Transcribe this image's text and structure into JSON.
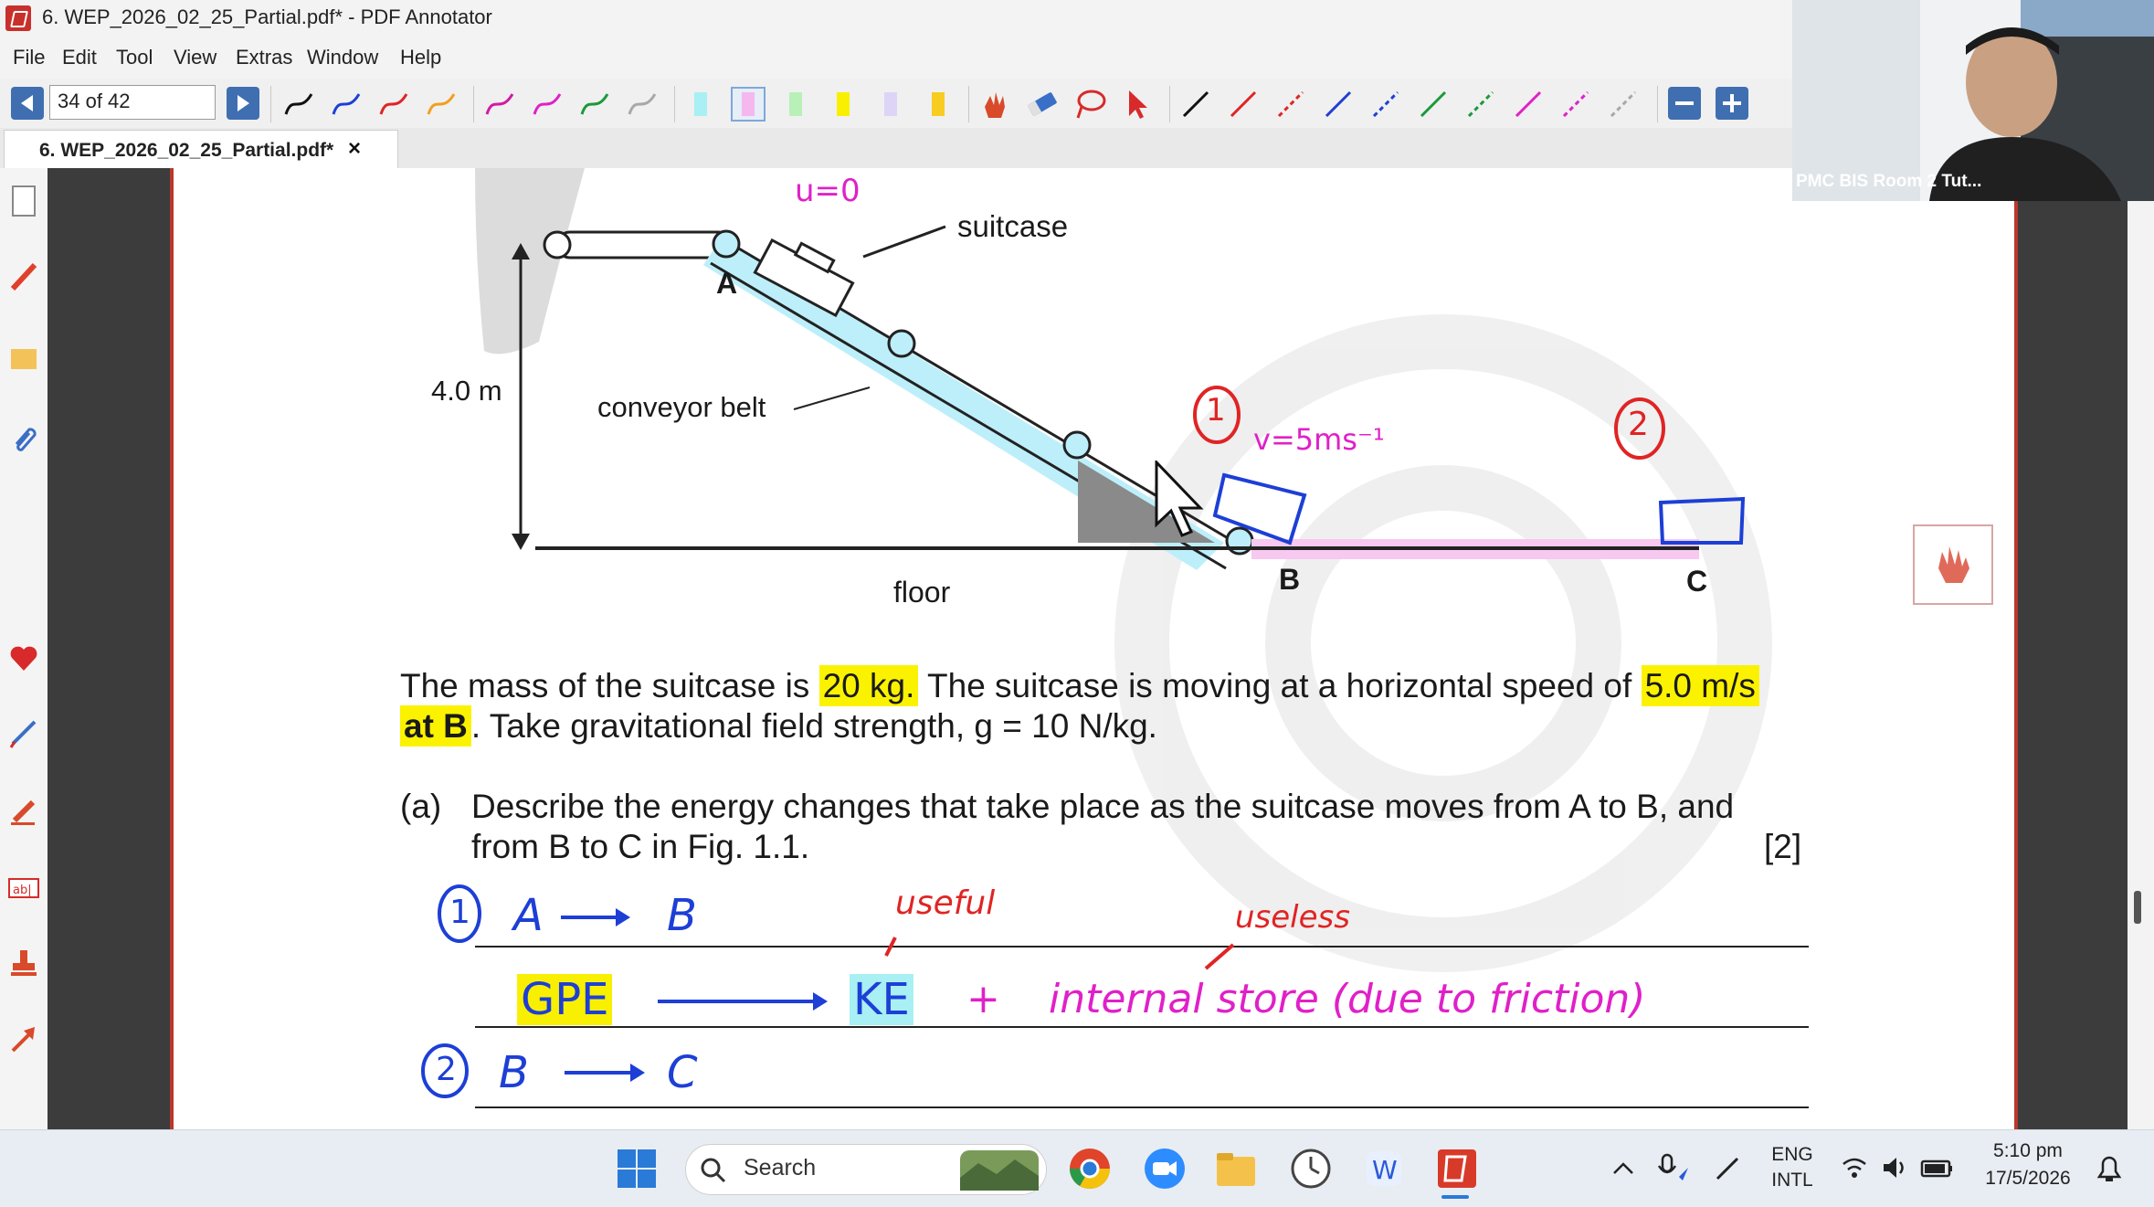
{
  "window": {
    "title": "6. WEP_2026_02_25_Partial.pdf* - PDF Annotator"
  },
  "menu": [
    "File",
    "Edit",
    "Tool",
    "View",
    "Extras",
    "Window",
    "Help"
  ],
  "toolbar": {
    "page_field": "34 of 42"
  },
  "tab": {
    "title": "6. WEP_2026_02_25_Partial.pdf*",
    "close": "×"
  },
  "document": {
    "diagram": {
      "suitcase_label": "suitcase",
      "point_a": "A",
      "height_label": "4.0 m",
      "belt_label": "conveyor belt",
      "point_b": "B",
      "point_c": "C",
      "floor_label": "floor"
    },
    "para": {
      "s1": "The mass of the suitcase is",
      "mass": "20 kg.",
      "s2": "The suitcase is moving at a horizontal speed of",
      "speed": "5.0 m/s",
      "at_b": "at B",
      "s3": ".  Take gravitational field strength, g = 10 N/kg."
    },
    "question": {
      "num": "(a)",
      "line1": "Describe the energy changes that take place as the suitcase moves from A to B, and",
      "line2": "from B to C in Fig. 1.1.",
      "marks": "[2]"
    },
    "handwriting": {
      "u0": "u=0",
      "circle1": "1",
      "v5": "v=5ms⁻¹",
      "circle2": "2",
      "ans1_num": "1",
      "ans1_a": "A",
      "ans1_b": "B",
      "useful": "useful",
      "useless": "useless",
      "gpe": "GPE",
      "ke": "KE",
      "plus": "+",
      "internal": "internal store (due to friction)",
      "ans2_num": "2",
      "ans2_b": "B",
      "ans2_c": "C"
    }
  },
  "webcam": {
    "label": "PMC BIS Room 2 Tut..."
  },
  "taskbar": {
    "search": "Search",
    "lang_line1": "ENG",
    "lang_line2": "INTL",
    "time": "5:10 pm",
    "date": "17/5/2026"
  }
}
